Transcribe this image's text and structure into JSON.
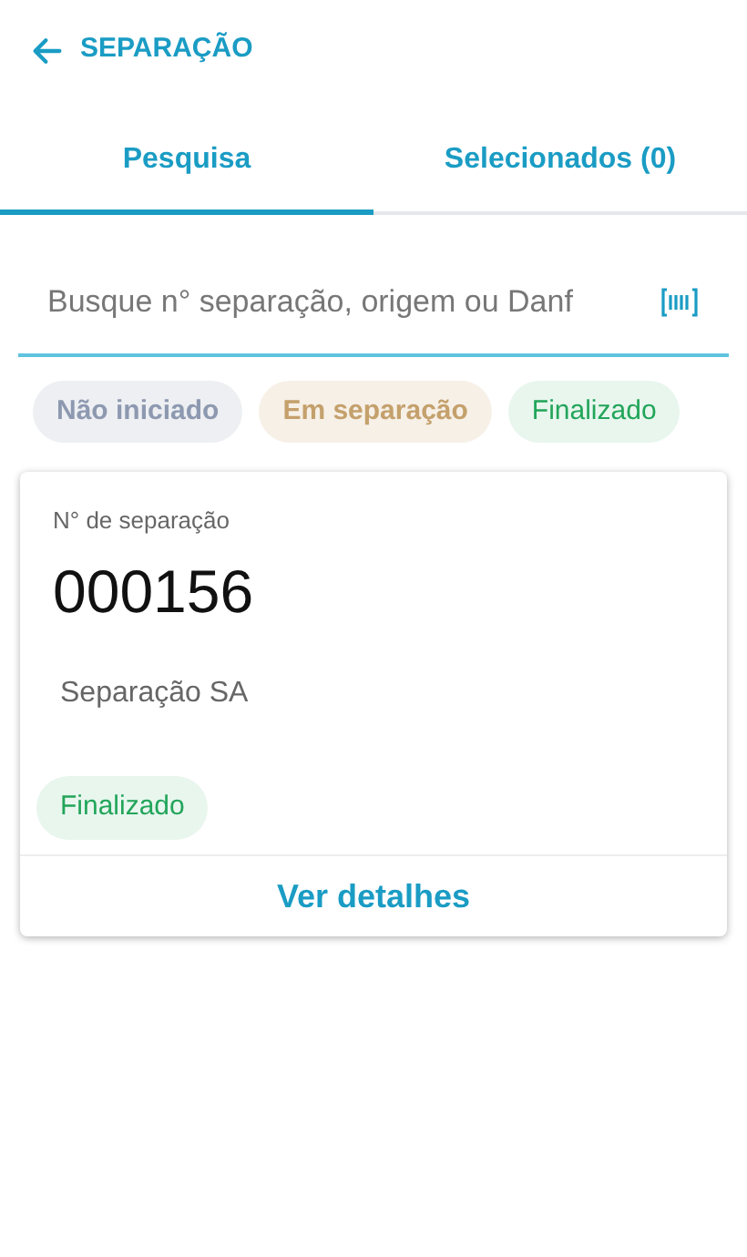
{
  "header": {
    "title": "SEPARAÇÃO"
  },
  "tabs": [
    {
      "label": "Pesquisa",
      "selected": true
    },
    {
      "label": "Selecionados (0)",
      "selected": false
    }
  ],
  "search": {
    "placeholder": "Busque n° separação, origem ou Danf"
  },
  "filters": [
    {
      "label": "Não iniciado",
      "selected": false,
      "color": "#8d99b0"
    },
    {
      "label": "Em separação",
      "selected": false,
      "color": "#c4a06c"
    },
    {
      "label": "Finalizado",
      "selected": true,
      "color": "#22a55a"
    }
  ],
  "cards": [
    {
      "label": "N° de separação",
      "number": "000156",
      "origin": "Separação SA",
      "status": "Finalizado",
      "action": "Ver detalhes"
    }
  ]
}
